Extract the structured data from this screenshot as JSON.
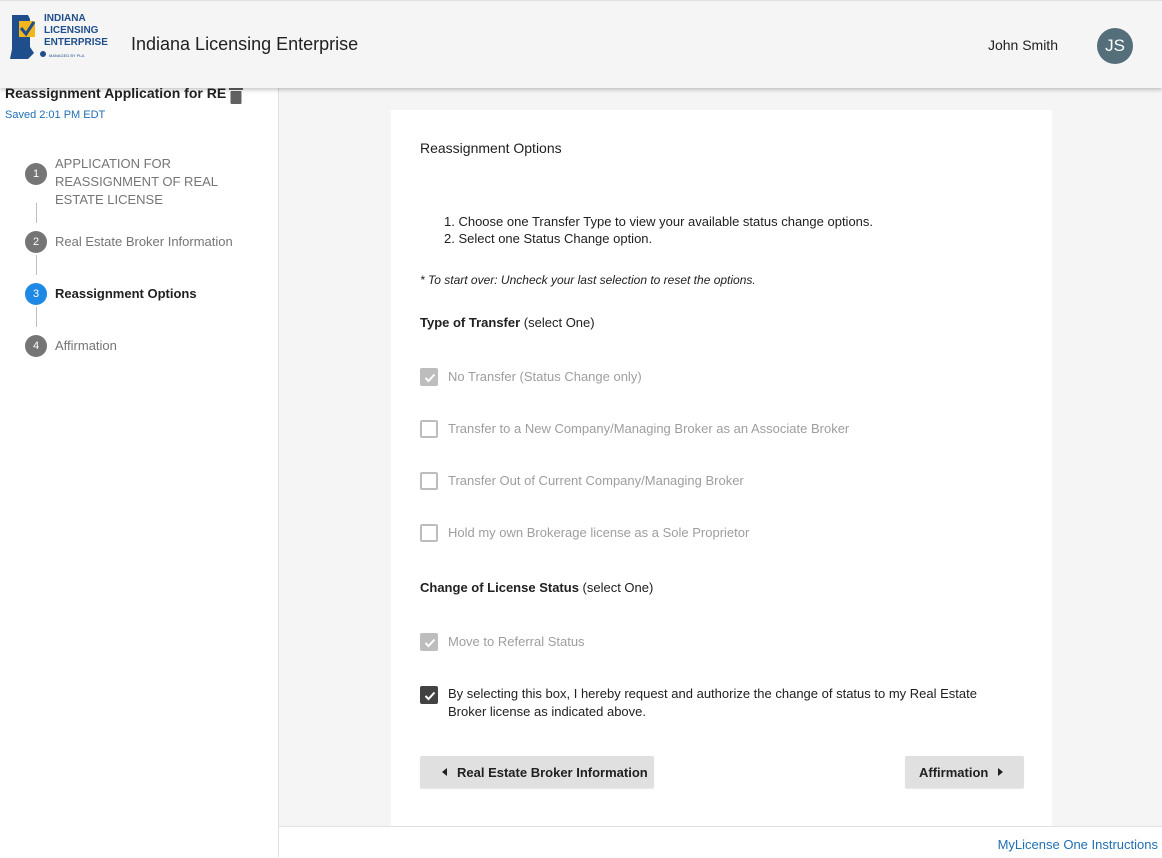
{
  "header": {
    "logo_line1": "INDIANA",
    "logo_line2": "LICENSING",
    "logo_line3": "ENTERPRISE",
    "logo_tagline": "MANAGED BY PLA",
    "title": "Indiana Licensing Enterprise",
    "user_name": "John Smith",
    "user_initials": "JS"
  },
  "sidebar": {
    "application_name": "Reassignment Application for RE",
    "saved_status": "Saved 2:01 PM EDT",
    "steps": [
      {
        "number": "1",
        "label_lines": [
          "APPLICATION FOR",
          "REASSIGNMENT OF REAL",
          "ESTATE LICENSE"
        ]
      },
      {
        "number": "2",
        "label": "Real Estate Broker Information"
      },
      {
        "number": "3",
        "label": "Reassignment Options",
        "active": true
      },
      {
        "number": "4",
        "label": "Affirmation"
      }
    ]
  },
  "main": {
    "section_title": "Reassignment Options",
    "instructions": [
      "1. Choose one Transfer Type to view your available status change options.",
      "2. Select one Status Change option."
    ],
    "note": "* To start over: Uncheck your last selection to reset the options.",
    "transfer_group": {
      "label_bold": "Type of Transfer",
      "label_rest": " (select One)",
      "options": [
        {
          "label": "No Transfer (Status Change only)",
          "checked": true,
          "disabled": true
        },
        {
          "label": "Transfer to a New Company/Managing Broker as an Associate Broker",
          "checked": false,
          "disabled": true
        },
        {
          "label": "Transfer Out of Current Company/Managing Broker",
          "checked": false,
          "disabled": true
        },
        {
          "label": "Hold my own Brokerage license as a Sole Proprietor",
          "checked": false,
          "disabled": true
        }
      ]
    },
    "status_group": {
      "label_bold": "Change of License Status",
      "label_rest": " (select One)",
      "options": [
        {
          "label": "Move to Referral Status",
          "checked": true,
          "disabled": true
        }
      ]
    },
    "authorization": {
      "label": "By selecting this box, I hereby request and authorize the change of status to my Real Estate Broker license as indicated above.",
      "checked": true
    },
    "back_button": "Real Estate Broker Information",
    "next_button": "Affirmation"
  },
  "footer": {
    "link": "MyLicense One Instructions"
  },
  "colors": {
    "accent": "#1e88e5",
    "link": "#1e6fb5",
    "avatar": "#546e7a",
    "logo_blue": "#1f4e8c",
    "logo_yellow": "#f2b51c"
  }
}
